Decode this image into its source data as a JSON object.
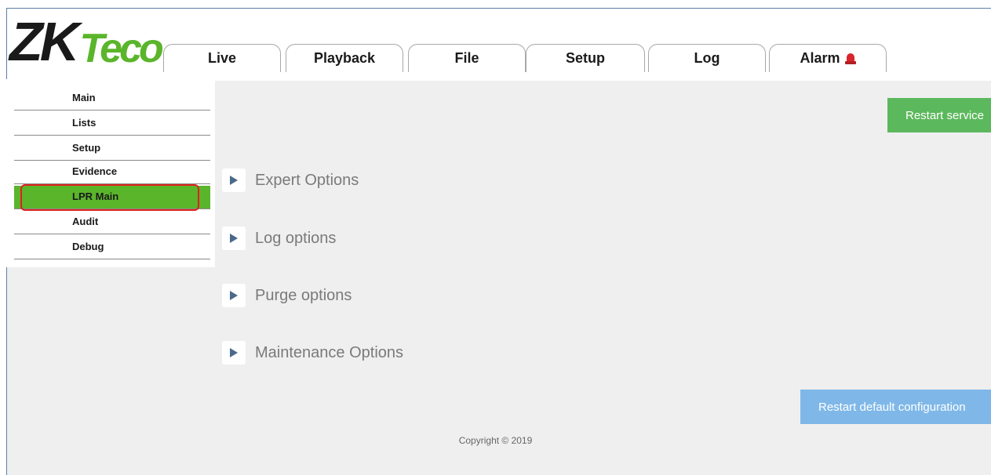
{
  "brand": {
    "logo_main": "ZK",
    "logo_accent": "Teco"
  },
  "tabs": [
    {
      "label": "Live"
    },
    {
      "label": "Playback"
    },
    {
      "label": "File"
    },
    {
      "label": "Setup"
    },
    {
      "label": "Log"
    },
    {
      "label": "Alarm",
      "icon": "alarm-siren-icon"
    }
  ],
  "sidebar": {
    "items": [
      {
        "label": "Main"
      },
      {
        "label": "Lists"
      },
      {
        "label": "Setup"
      },
      {
        "label": "Evidence"
      },
      {
        "label": "LPR Main",
        "active": true
      },
      {
        "label": "Audit"
      },
      {
        "label": "Debug"
      }
    ]
  },
  "sections": [
    {
      "label": "Expert Options"
    },
    {
      "label": "Log options"
    },
    {
      "label": "Purge options"
    },
    {
      "label": "Maintenance Options"
    }
  ],
  "buttons": {
    "restart_service": "Restart service",
    "restart_default": "Restart default configuration"
  },
  "footer": {
    "copyright": "Copyright © 2019"
  },
  "colors": {
    "accent_green": "#5ab52b",
    "button_green": "#5cb85c",
    "button_blue": "#7fb8e8",
    "highlight_red": "#e02020"
  }
}
